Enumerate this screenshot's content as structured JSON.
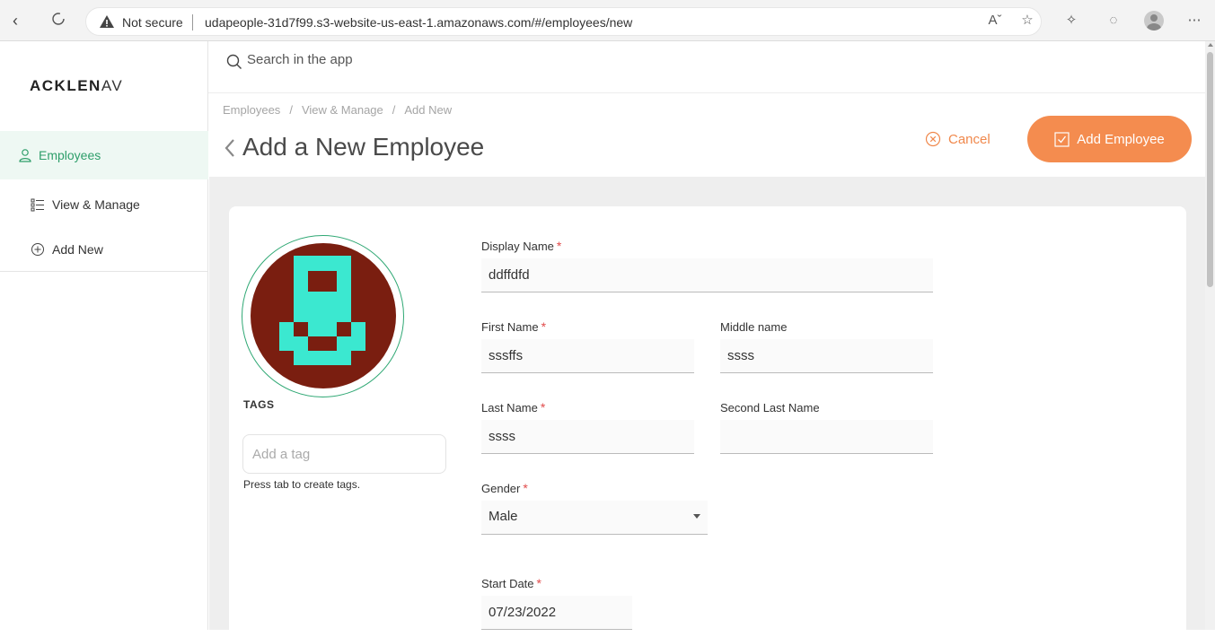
{
  "browser": {
    "security_label": "Not secure",
    "url_main": "udapeople-31d7f99.s3-website-us-east-1.amazonaws.com",
    "url_path": "/#/employees/new"
  },
  "sidebar": {
    "logo_bold": "ACKLEN",
    "logo_thin": "AV",
    "items": [
      {
        "label": "Employees",
        "icon": "user-icon",
        "active": true
      },
      {
        "label": "View & Manage",
        "icon": "list-icon",
        "active": false
      },
      {
        "label": "Add New",
        "icon": "plus-circle-icon",
        "active": false
      }
    ]
  },
  "search": {
    "placeholder": "Search in the app"
  },
  "breadcrumb": [
    "Employees",
    "View & Manage",
    "Add New"
  ],
  "page_title": "Add a New Employee",
  "actions": {
    "cancel_label": "Cancel",
    "add_label": "Add Employee"
  },
  "tags": {
    "label": "TAGS",
    "placeholder": "Add a tag",
    "hint": "Press tab to create tags."
  },
  "form": {
    "display_name": {
      "label": "Display Name",
      "value": "ddffdfd"
    },
    "first_name": {
      "label": "First Name",
      "value": "sssffs"
    },
    "middle_name": {
      "label": "Middle name",
      "value": "ssss"
    },
    "last_name": {
      "label": "Last Name",
      "value": "ssss"
    },
    "second_last_name": {
      "label": "Second Last Name",
      "value": ""
    },
    "gender": {
      "label": "Gender",
      "value": "Male"
    },
    "start_date": {
      "label": "Start Date",
      "value": "07/23/2022"
    }
  },
  "colors": {
    "accent_green": "#2e9e6a",
    "accent_orange": "#f48c4f",
    "required_red": "#e14b4b",
    "avatar_bg": "#7a1e10",
    "avatar_fg": "#3be8d0"
  }
}
